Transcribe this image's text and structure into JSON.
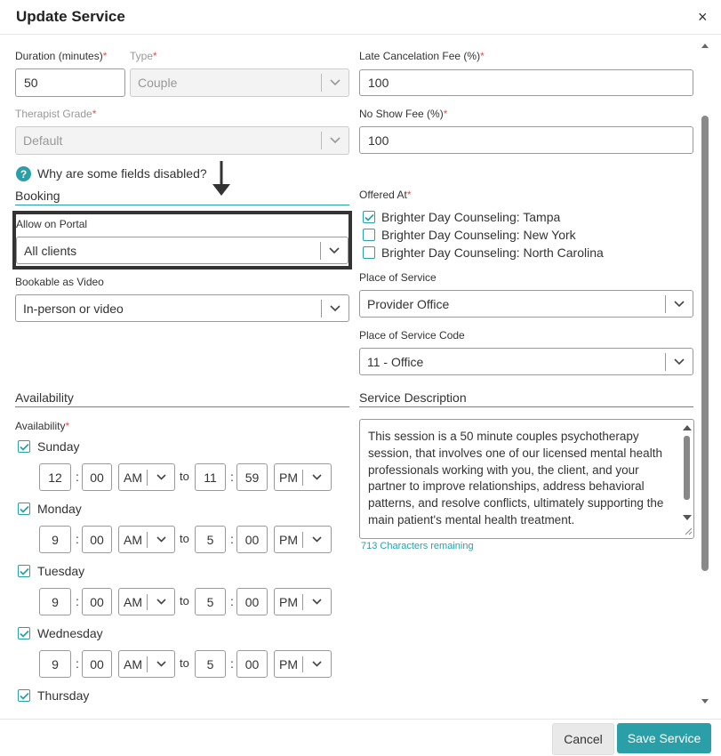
{
  "dialog": {
    "title": "Update Service",
    "close_glyph": "×"
  },
  "fields": {
    "duration_label": "Duration (minutes)",
    "duration_value": "50",
    "type_label": "Type",
    "type_value": "Couple",
    "late_fee_label": "Late Cancelation Fee (%)",
    "late_fee_value": "100",
    "therapist_grade_label": "Therapist Grade",
    "therapist_grade_value": "Default",
    "no_show_label": "No Show Fee (%)",
    "no_show_value": "100",
    "required_mark": "*",
    "help_glyph": "?",
    "help_text": "Why are some fields disabled?"
  },
  "booking": {
    "section_title": "Booking",
    "portal_label": "Allow on Portal",
    "portal_value": "All clients",
    "video_label": "Bookable as Video",
    "video_value": "In-person or video"
  },
  "offered_at": {
    "label": "Offered At",
    "locations": [
      {
        "name": "Brighter Day Counseling: Tampa",
        "checked": true
      },
      {
        "name": "Brighter Day Counseling: New York",
        "checked": false
      },
      {
        "name": "Brighter Day Counseling: North Carolina",
        "checked": false
      }
    ],
    "place_label": "Place of Service",
    "place_value": "Provider Office",
    "place_code_label": "Place of Service Code",
    "place_code_value": "11 - Office"
  },
  "availability": {
    "section_title": "Availability",
    "label": "Availability",
    "to_label": "to",
    "days": [
      {
        "name": "Sunday",
        "checked": true,
        "start_h": "12",
        "start_m": "00",
        "start_ampm": "AM",
        "end_h": "11",
        "end_m": "59",
        "end_ampm": "PM"
      },
      {
        "name": "Monday",
        "checked": true,
        "start_h": "9",
        "start_m": "00",
        "start_ampm": "AM",
        "end_h": "5",
        "end_m": "00",
        "end_ampm": "PM"
      },
      {
        "name": "Tuesday",
        "checked": true,
        "start_h": "9",
        "start_m": "00",
        "start_ampm": "AM",
        "end_h": "5",
        "end_m": "00",
        "end_ampm": "PM"
      },
      {
        "name": "Wednesday",
        "checked": true,
        "start_h": "9",
        "start_m": "00",
        "start_ampm": "AM",
        "end_h": "5",
        "end_m": "00",
        "end_ampm": "PM"
      },
      {
        "name": "Thursday",
        "checked": true
      }
    ]
  },
  "description": {
    "section_title": "Service Description",
    "text": "This session is a 50 minute couples psychotherapy session, that involves one of our licensed mental health professionals working with you, the client, and your partner to improve relationships, address behavioral patterns, and resolve conflicts, ultimately supporting the main patient's mental health treatment.",
    "remaining": "713 Characters remaining"
  },
  "footer": {
    "cancel_label": "Cancel",
    "save_label": "Save Service"
  },
  "colors": {
    "accent": "#2a9fa8",
    "required": "#d9534f",
    "highlight_border": "#333333"
  },
  "icons": {
    "close": "close-icon",
    "help": "help-icon",
    "chevron": "chevron-down-icon",
    "check": "checkmark-icon",
    "arrow": "arrow-down-icon"
  }
}
